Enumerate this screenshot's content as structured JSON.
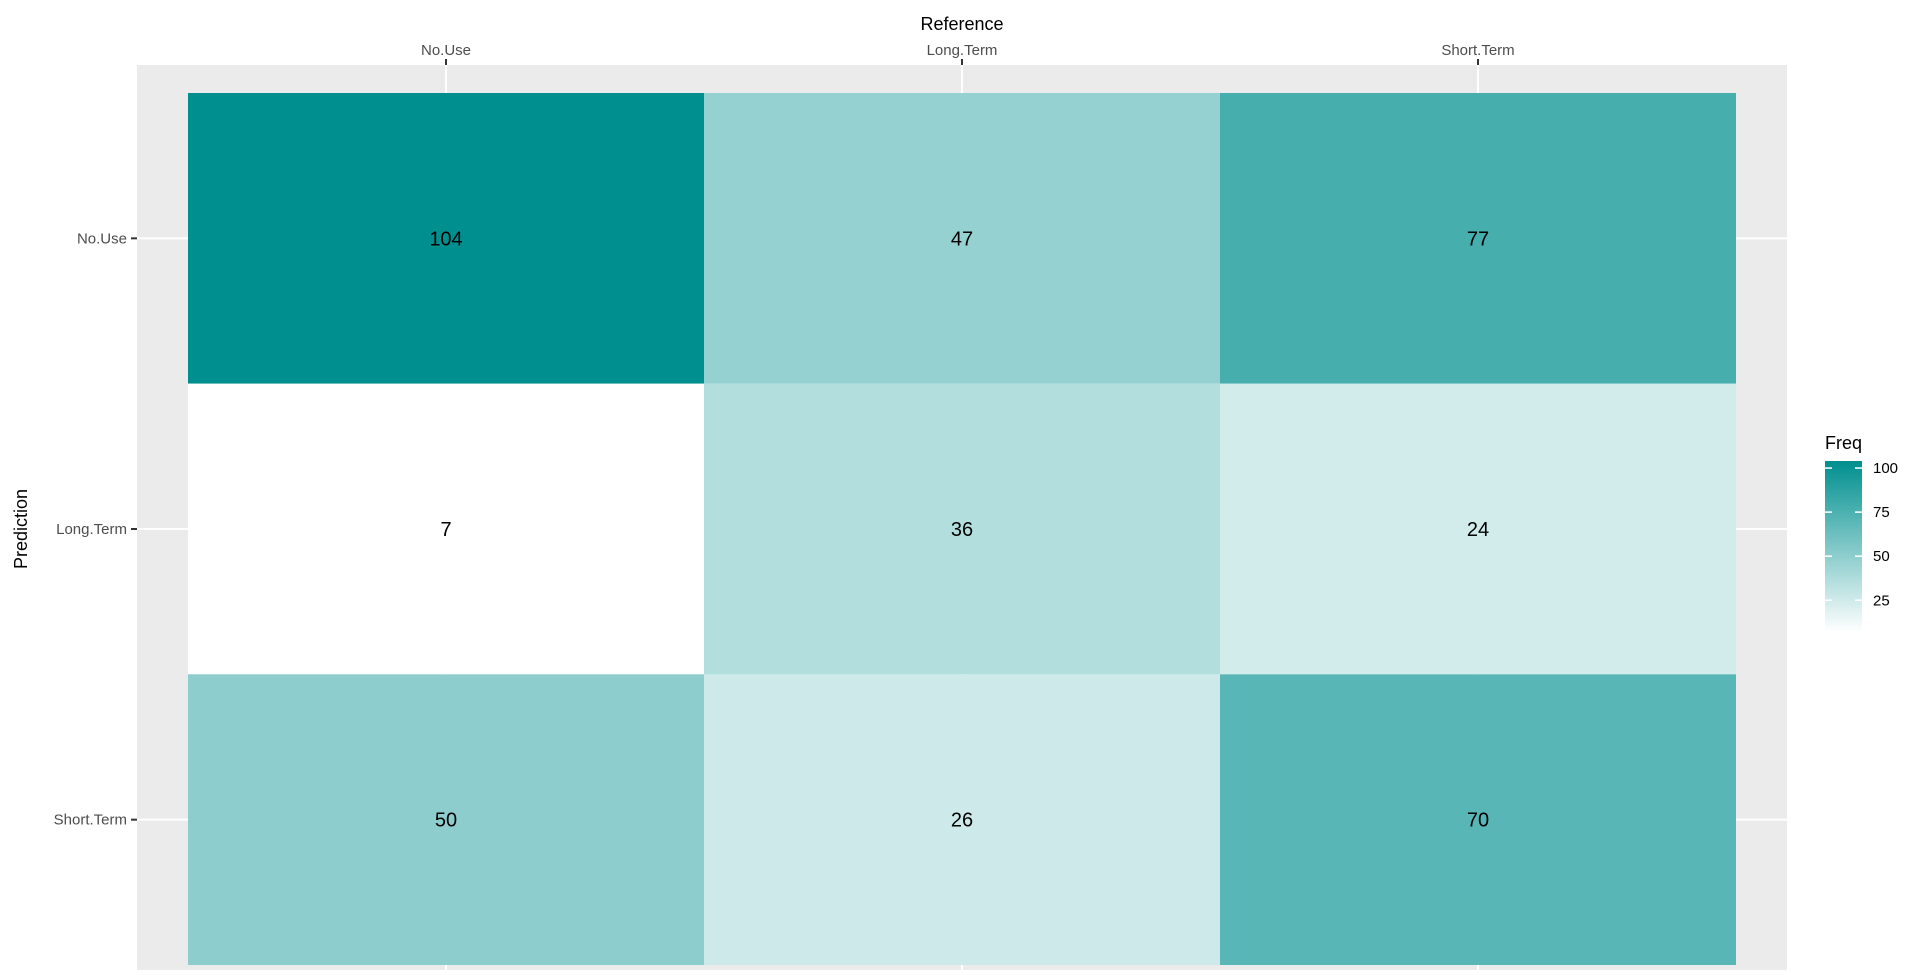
{
  "chart_data": {
    "type": "heatmap",
    "xlabel": "Reference",
    "ylabel": "Prediction",
    "x_categories": [
      "No.Use",
      "Long.Term",
      "Short.Term"
    ],
    "y_categories": [
      "No.Use",
      "Long.Term",
      "Short.Term"
    ],
    "x_axis_position": "top",
    "values": [
      [
        104,
        47,
        77
      ],
      [
        7,
        36,
        24
      ],
      [
        50,
        26,
        70
      ]
    ],
    "legend": {
      "title": "Freq",
      "ticks": [
        25,
        50,
        75,
        100
      ],
      "range": [
        7,
        104
      ],
      "low_color": "#ffffff",
      "high_color": "#008f8f",
      "placement": "right"
    },
    "panel_background": "#ebebeb",
    "grid": true
  }
}
